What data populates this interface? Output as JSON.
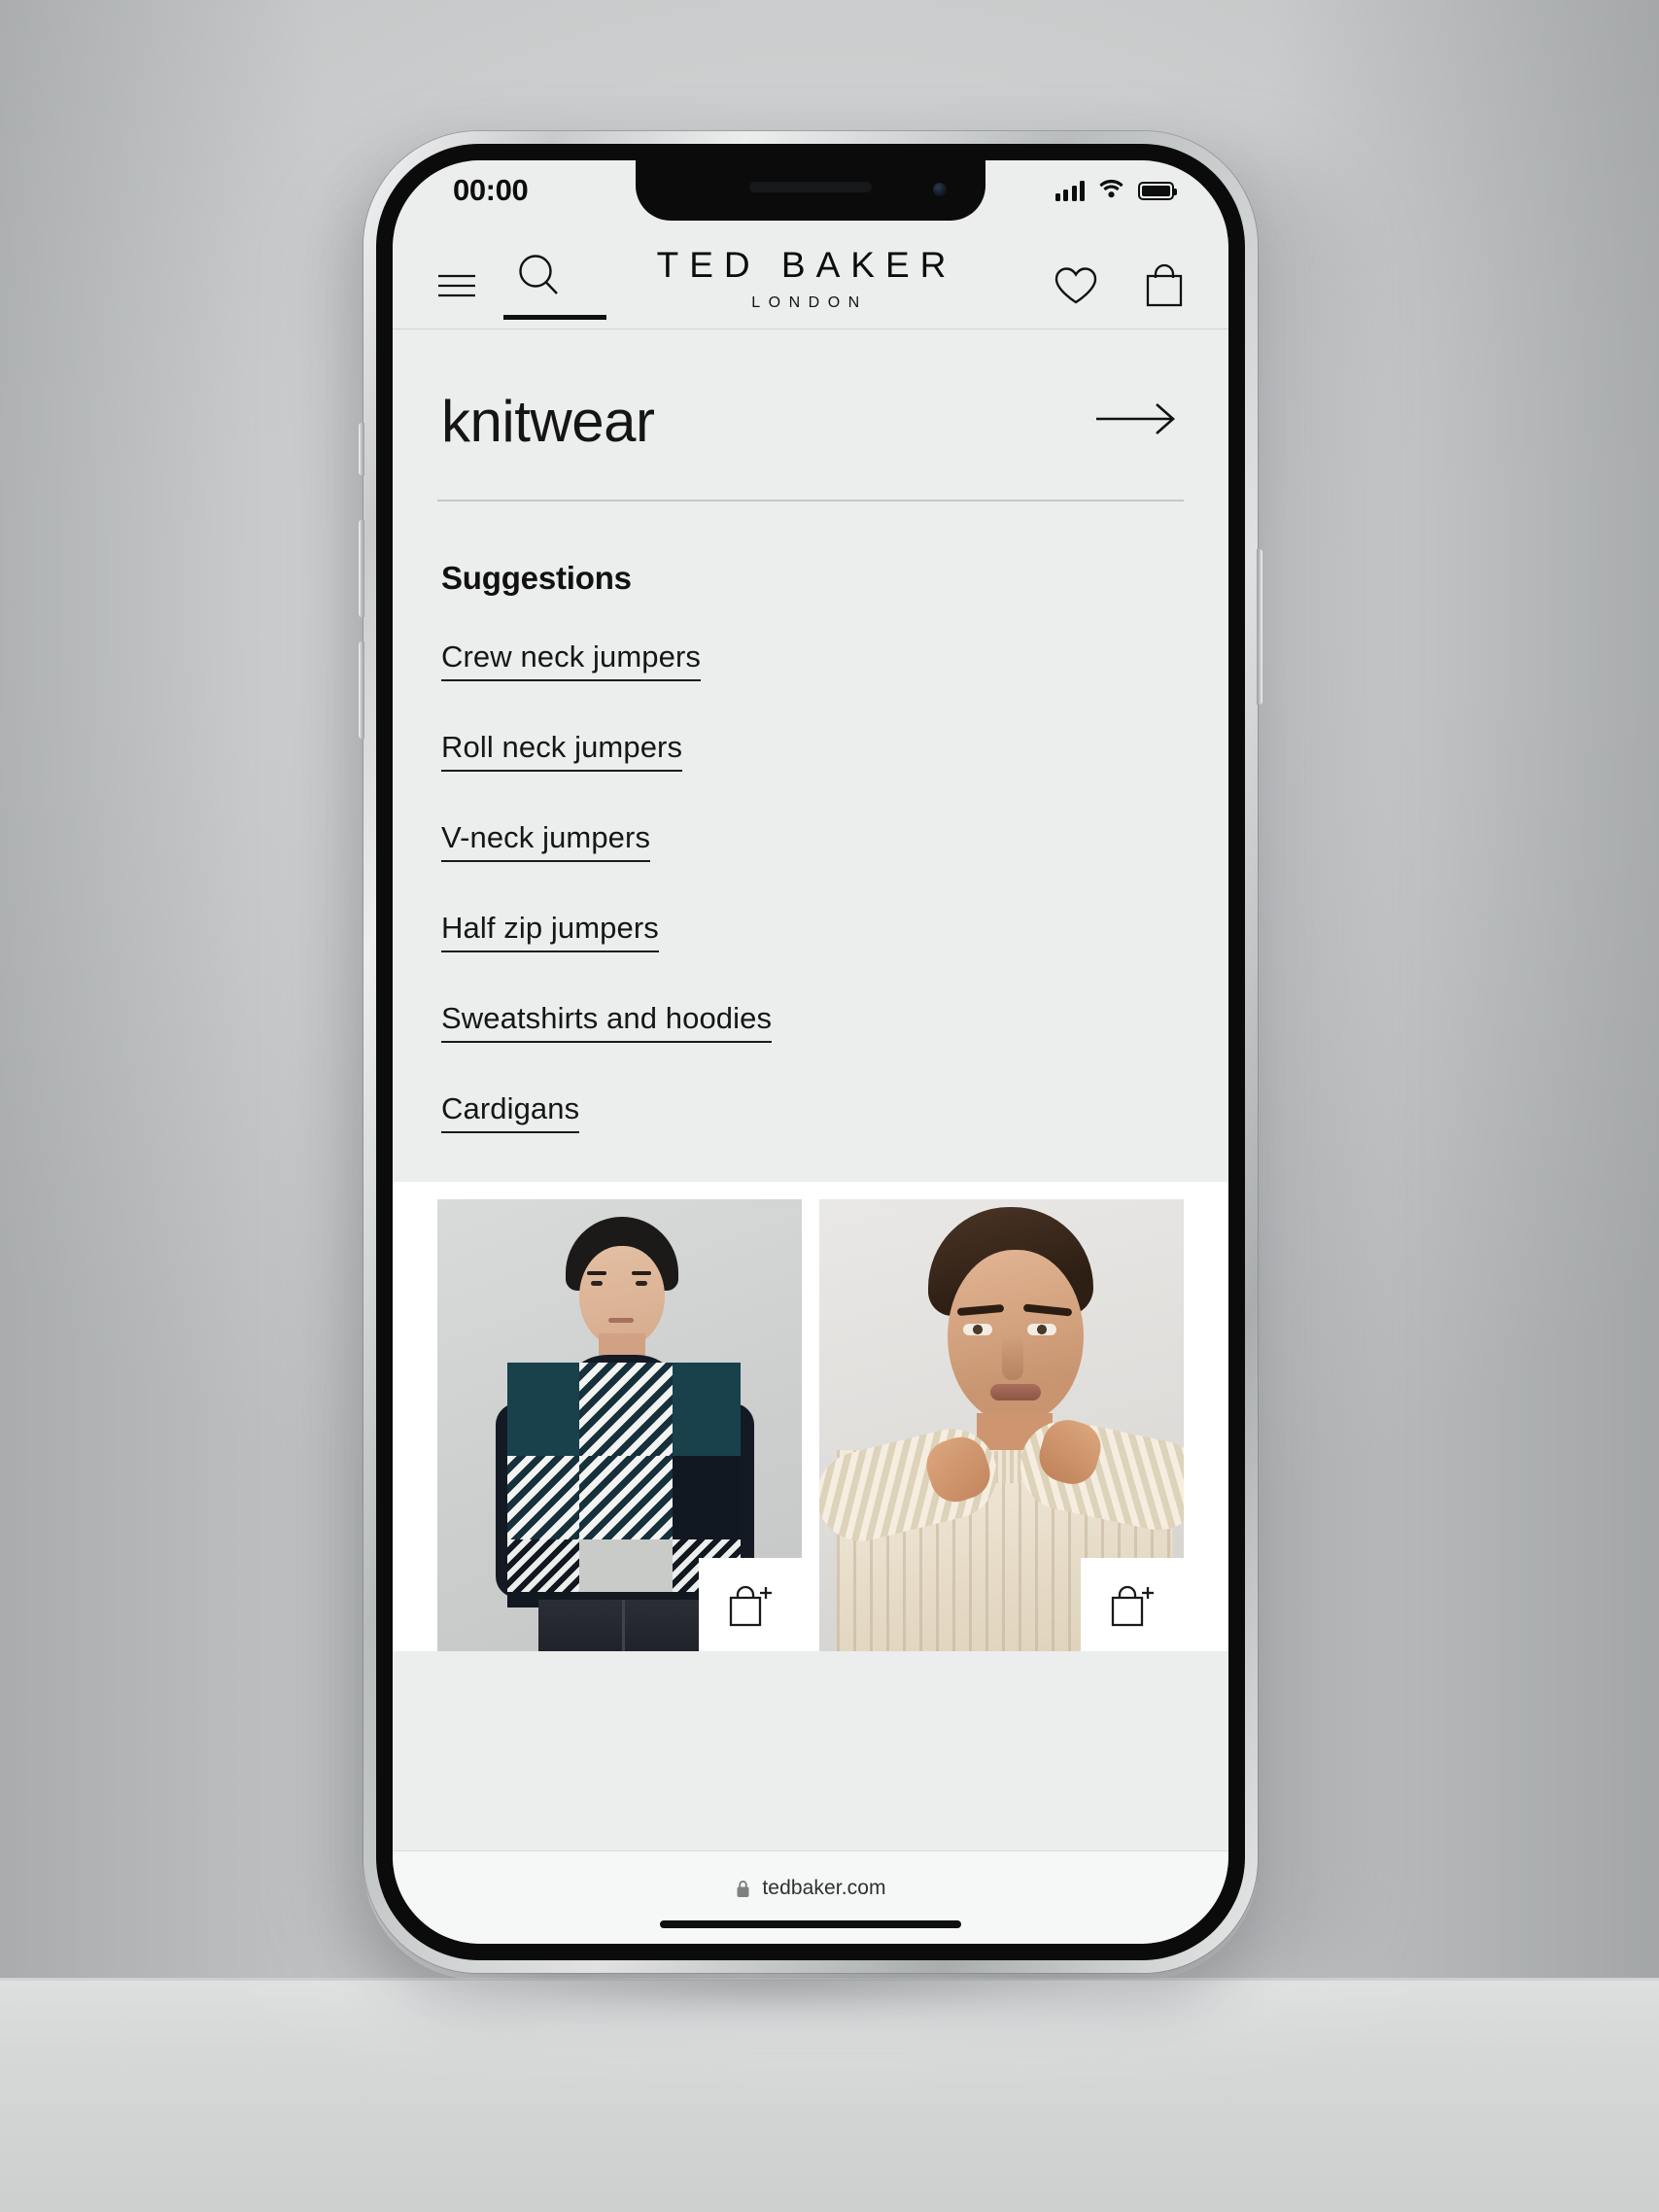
{
  "device": {
    "status_bar": {
      "clock": "00:00",
      "signal_icon": "cellular-signal-icon",
      "wifi_icon": "wifi-icon",
      "battery_icon": "battery-full-icon"
    },
    "notch": {
      "speaker_icon": "speaker-grille-icon",
      "camera_icon": "front-camera-icon"
    },
    "side_buttons": {
      "mute": "mute-switch",
      "volume_up": "volume-up-button",
      "volume_down": "volume-down-button",
      "power": "power-button"
    }
  },
  "header": {
    "menu_icon": "hamburger-menu-icon",
    "search_icon": "search-icon",
    "wishlist_icon": "heart-icon",
    "bag_icon": "shopping-bag-icon",
    "brand_name": "TED BAKER",
    "brand_sub": "LONDON"
  },
  "search": {
    "value": "knitwear",
    "placeholder": "Search",
    "submit_icon": "arrow-right-icon"
  },
  "suggestions": {
    "title": "Suggestions",
    "items": [
      {
        "label": "Crew neck jumpers"
      },
      {
        "label": "Roll neck jumpers"
      },
      {
        "label": "V-neck jumpers"
      },
      {
        "label": "Half zip jumpers"
      },
      {
        "label": "Sweatshirts and hoodies"
      },
      {
        "label": "Cardigans"
      }
    ]
  },
  "products": [
    {
      "alt": "Model wearing navy teal and grey patchwork striped crew neck jumper",
      "add_to_bag_icon": "bag-plus-icon"
    },
    {
      "alt": "Model wearing cream ribbed knit crew neck jumper",
      "add_to_bag_icon": "bag-plus-icon"
    }
  ],
  "browser": {
    "lock_icon": "lock-icon",
    "url": "tedbaker.com",
    "home_indicator": "home-indicator"
  },
  "colors": {
    "page_background": "#eceded",
    "text": "#151515",
    "accent_underline": "#101010",
    "studio_background": "#cdcfcf",
    "product_card_white": "#ffffff"
  }
}
